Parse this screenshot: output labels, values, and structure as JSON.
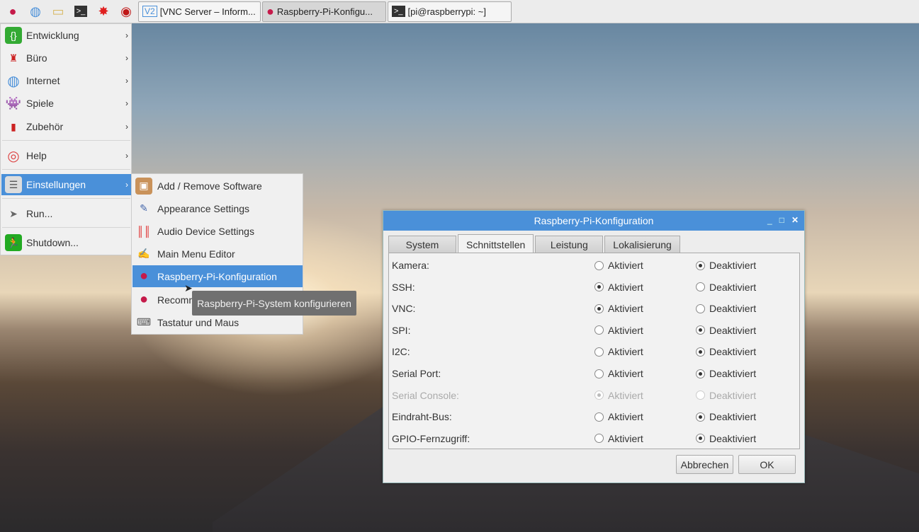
{
  "taskbar": {
    "launchers": [
      "raspberry-menu",
      "web-browser",
      "file-manager",
      "terminal",
      "mathematica",
      "wolfram"
    ],
    "tasks": [
      {
        "label": "[VNC Server – Inform...",
        "icon": "vnc-icon"
      },
      {
        "label": "Raspberry-Pi-Konfigu...",
        "icon": "raspberry-icon"
      },
      {
        "label": "[pi@raspberrypi: ~]",
        "icon": "terminal-icon"
      }
    ]
  },
  "menu": {
    "items": [
      {
        "label": "Entwicklung"
      },
      {
        "label": "Büro"
      },
      {
        "label": "Internet"
      },
      {
        "label": "Spiele"
      },
      {
        "label": "Zubehör"
      },
      {
        "label": "Help"
      },
      {
        "label": "Einstellungen"
      },
      {
        "label": "Run..."
      },
      {
        "label": "Shutdown..."
      }
    ]
  },
  "submenu": {
    "items": [
      {
        "label": "Add / Remove Software"
      },
      {
        "label": "Appearance Settings"
      },
      {
        "label": "Audio Device Settings"
      },
      {
        "label": "Main Menu Editor"
      },
      {
        "label": "Raspberry-Pi-Konfiguration"
      },
      {
        "label": "Recomm"
      },
      {
        "label": "Tastatur und Maus"
      }
    ]
  },
  "tooltip": "Raspberry-Pi-System konfigurieren",
  "dialog": {
    "title": "Raspberry-Pi-Konfiguration",
    "tabs": [
      "System",
      "Schnittstellen",
      "Leistung",
      "Lokalisierung"
    ],
    "active_tab": "Schnittstellen",
    "on_label": "Aktiviert",
    "off_label": "Deaktiviert",
    "rows": [
      {
        "label": "Kamera:",
        "enabled": false
      },
      {
        "label": "SSH:",
        "enabled": true
      },
      {
        "label": "VNC:",
        "enabled": true
      },
      {
        "label": "SPI:",
        "enabled": false
      },
      {
        "label": "I2C:",
        "enabled": false
      },
      {
        "label": "Serial Port:",
        "enabled": false
      },
      {
        "label": "Serial Console:",
        "enabled": true,
        "disabled": true
      },
      {
        "label": "Eindraht-Bus:",
        "enabled": false
      },
      {
        "label": "GPIO-Fernzugriff:",
        "enabled": false
      }
    ],
    "cancel": "Abbrechen",
    "ok": "OK"
  },
  "colors": {
    "accent": "#4a90d9"
  }
}
